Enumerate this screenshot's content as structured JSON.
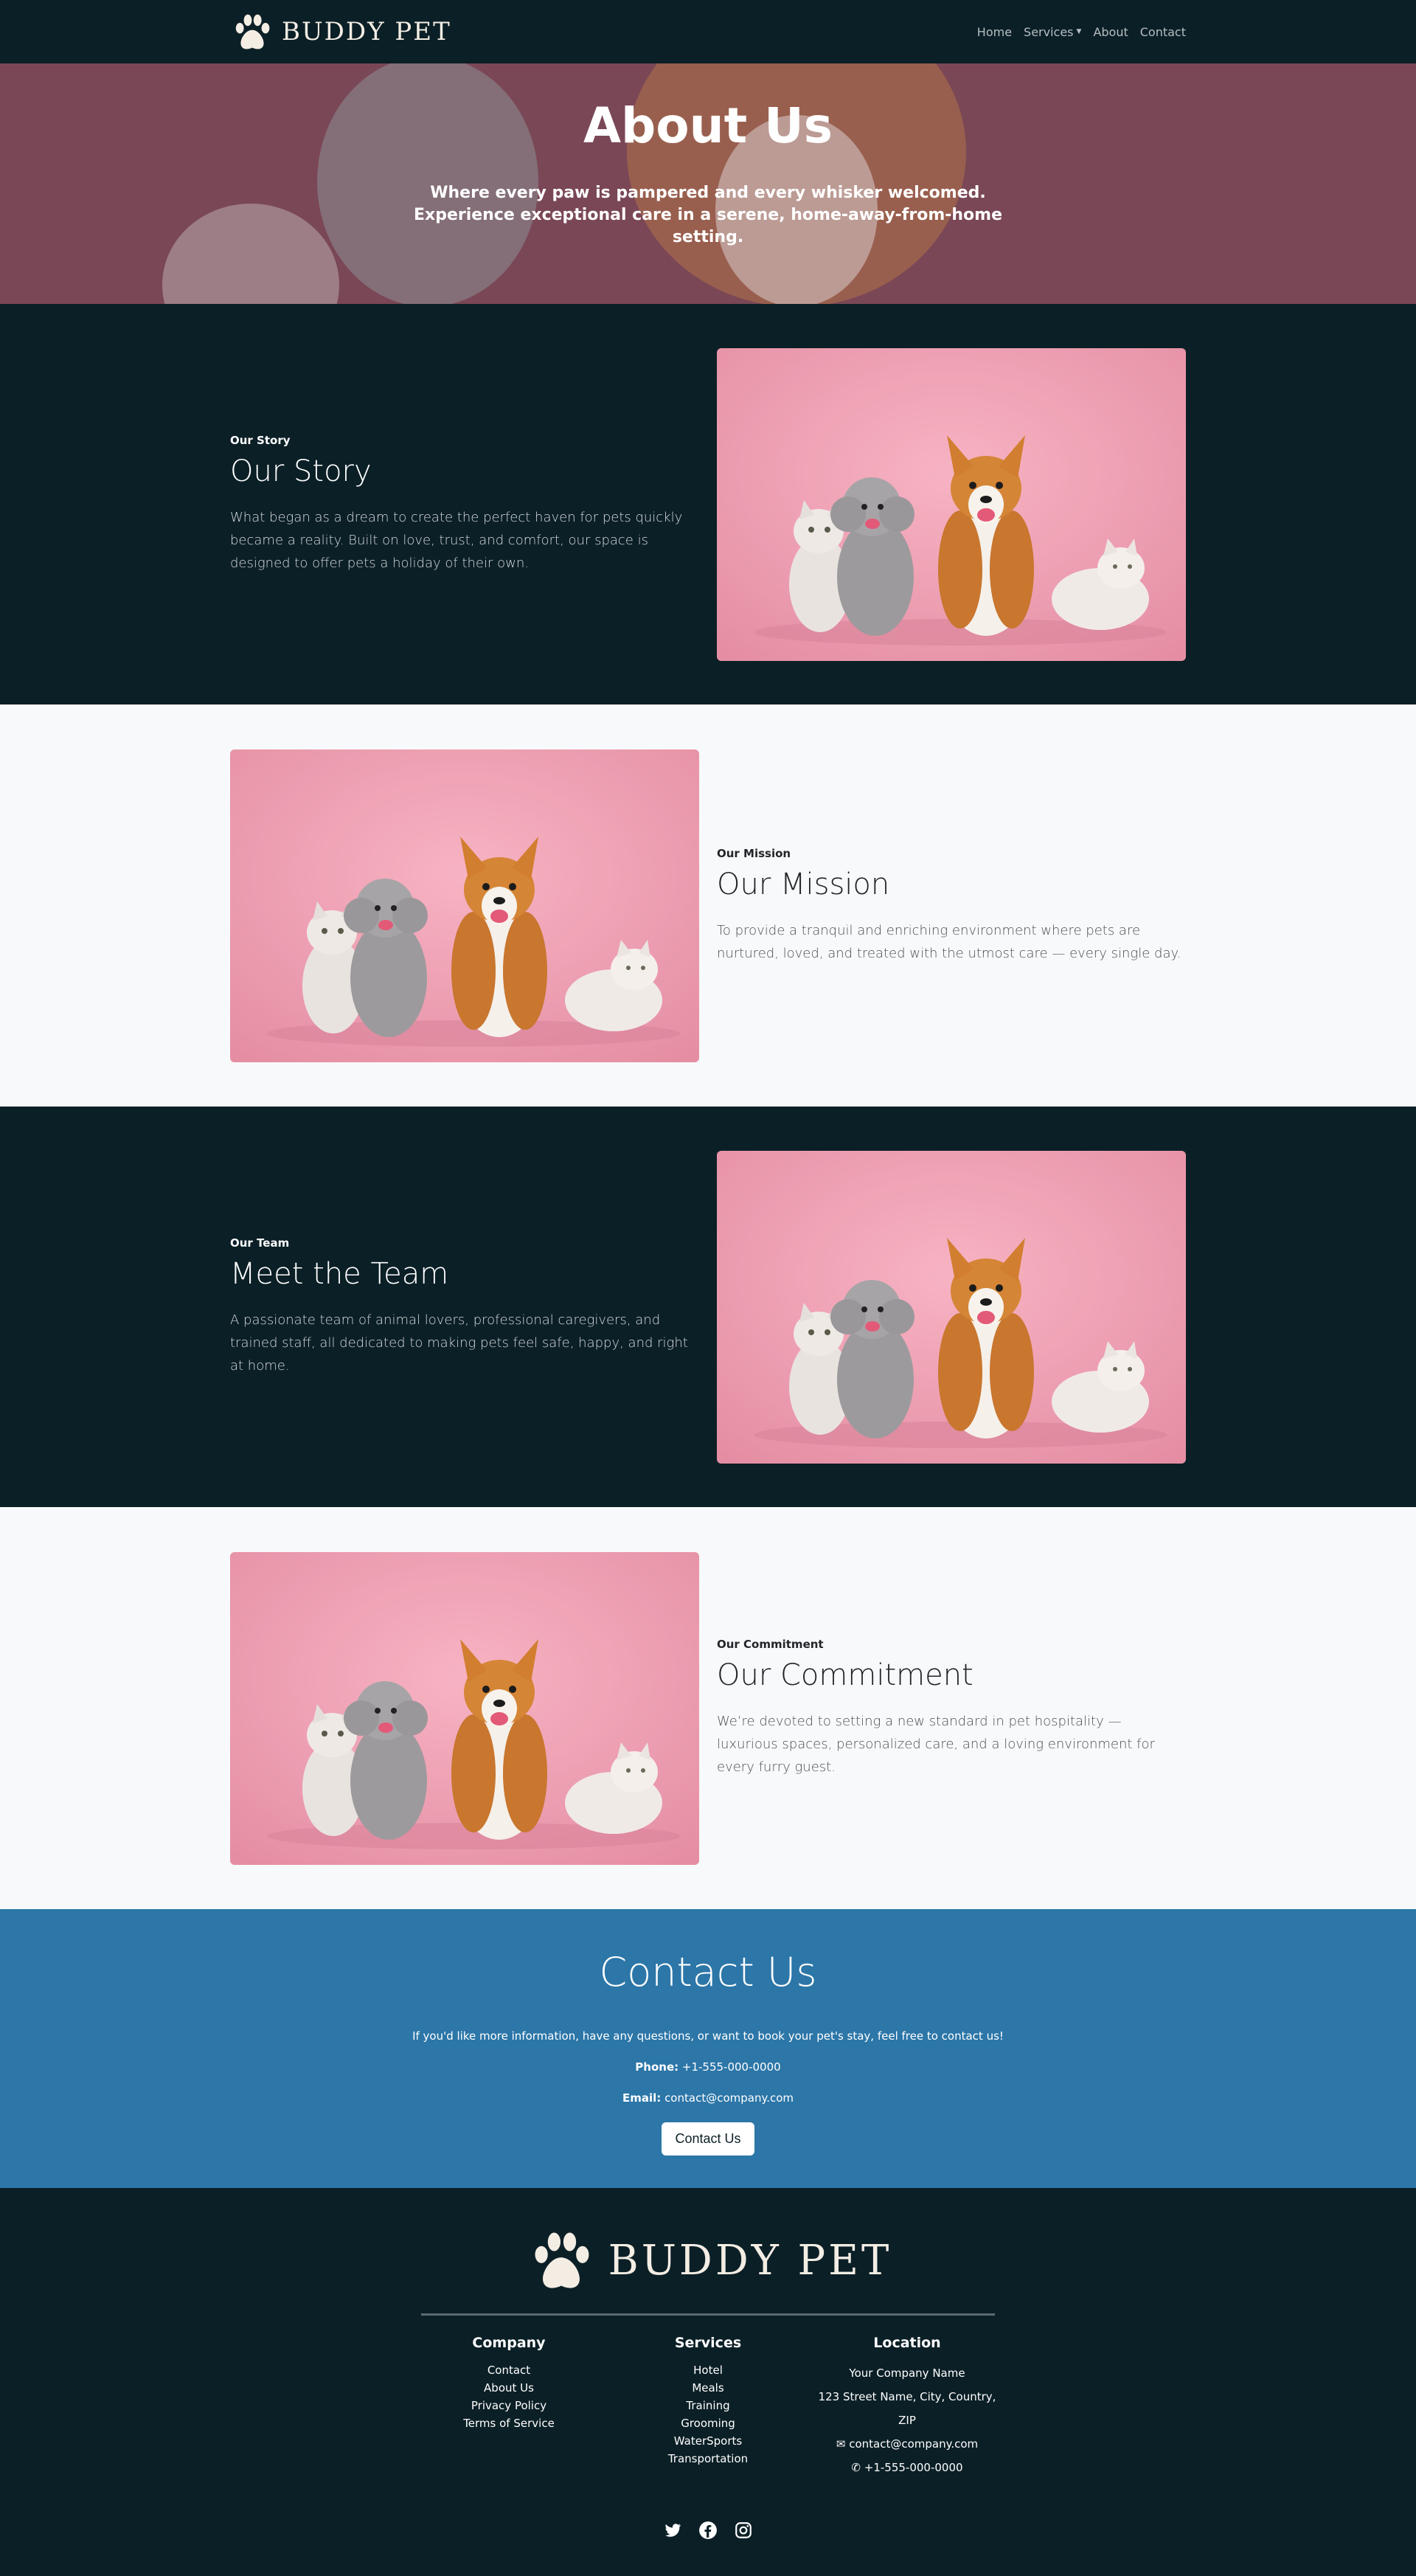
{
  "nav": {
    "brand": "BUDDY PET",
    "links": [
      "Home",
      "Services",
      "About",
      "Contact"
    ]
  },
  "hero": {
    "title": "About Us",
    "subtitle": "Where every paw is pampered and every whisker welcomed. Experience exceptional care in a serene, home-away-from-home setting."
  },
  "sections": [
    {
      "kicker": "Our Story",
      "heading": "Our Story",
      "body": "What began as a dream to create the perfect haven for pets quickly became a reality. Built on love, trust, and comfort, our space is designed to offer pets a holiday of their own."
    },
    {
      "kicker": "Our Mission",
      "heading": "Our Mission",
      "body": "To provide a tranquil and enriching environment where pets are nurtured, loved, and treated with the utmost care — every single day."
    },
    {
      "kicker": "Our Team",
      "heading": "Meet the Team",
      "body": "A passionate team of animal lovers, professional caregivers, and trained staff, all dedicated to making pets feel safe, happy, and right at home."
    },
    {
      "kicker": "Our Commitment",
      "heading": "Our Commitment",
      "body": "We’re devoted to setting a new standard in pet hospitality — luxurious spaces, personalized care, and a loving environment for every furry guest."
    }
  ],
  "contact": {
    "title": "Contact Us",
    "intro": "If you'd like more information, have any questions, or want to book your pet's stay, feel free to contact us!",
    "phone_label": "Phone:",
    "phone": "+1-555-000-0000",
    "email_label": "Email:",
    "email": "contact@company.com",
    "button": "Contact Us"
  },
  "footer": {
    "brand": "BUDDY PET",
    "company": {
      "title": "Company",
      "items": [
        "Contact",
        "About Us",
        "Privacy Policy",
        "Terms of Service"
      ]
    },
    "services": {
      "title": "Services",
      "items": [
        "Hotel",
        "Meals",
        "Training",
        "Grooming",
        "WaterSports",
        "Transportation"
      ]
    },
    "location": {
      "title": "Location",
      "name": "Your Company Name",
      "address": "123 Street Name, City, Country, ZIP",
      "email": "contact@company.com",
      "phone": "+1-555-000-0000"
    },
    "social_icons": [
      "twitter-icon",
      "facebook-icon",
      "instagram-icon"
    ]
  },
  "colors": {
    "dark": "#0b1f26",
    "light": "#f8f9fa",
    "contact_blue": "#2c76a8",
    "photo_pink": "#f1a6b8"
  }
}
